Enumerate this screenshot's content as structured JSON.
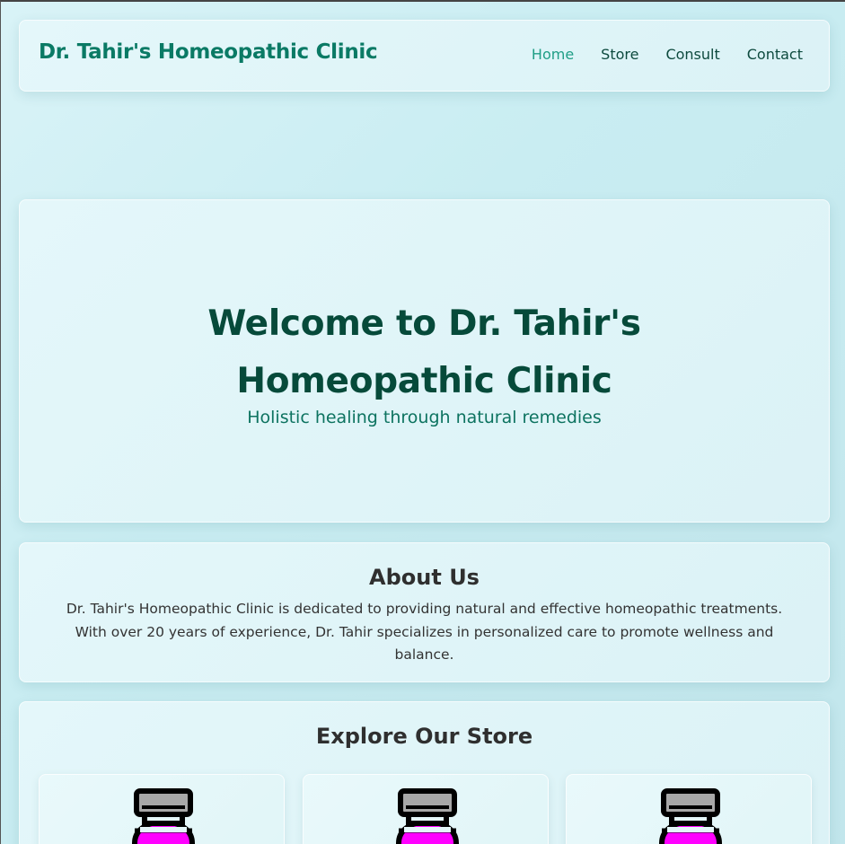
{
  "header": {
    "brand": "Dr. Tahir's Homeopathic Clinic",
    "nav": [
      "Home",
      "Store",
      "Consult",
      "Contact"
    ]
  },
  "hero": {
    "title": "Welcome to Dr. Tahir's Homeopathic Clinic",
    "subtitle": "Holistic healing through natural remedies"
  },
  "about": {
    "heading": "About Us",
    "text": "Dr. Tahir's Homeopathic Clinic is dedicated to providing natural and effective homeopathic treatments. With over 20 years of experience, Dr. Tahir specializes in personalized care to promote wellness and balance."
  },
  "store": {
    "heading": "Explore Our Store",
    "products": [
      {
        "icon": "medicine-bottle-icon"
      },
      {
        "icon": "medicine-bottle-icon"
      },
      {
        "icon": "medicine-bottle-icon"
      }
    ]
  },
  "colors": {
    "brand": "#0a7a65",
    "nav_active": "#1f9e86",
    "hero_title": "#064a3a",
    "bottle_liquid": "#ff00ff",
    "bottle_cap": "#a8a8a8"
  }
}
